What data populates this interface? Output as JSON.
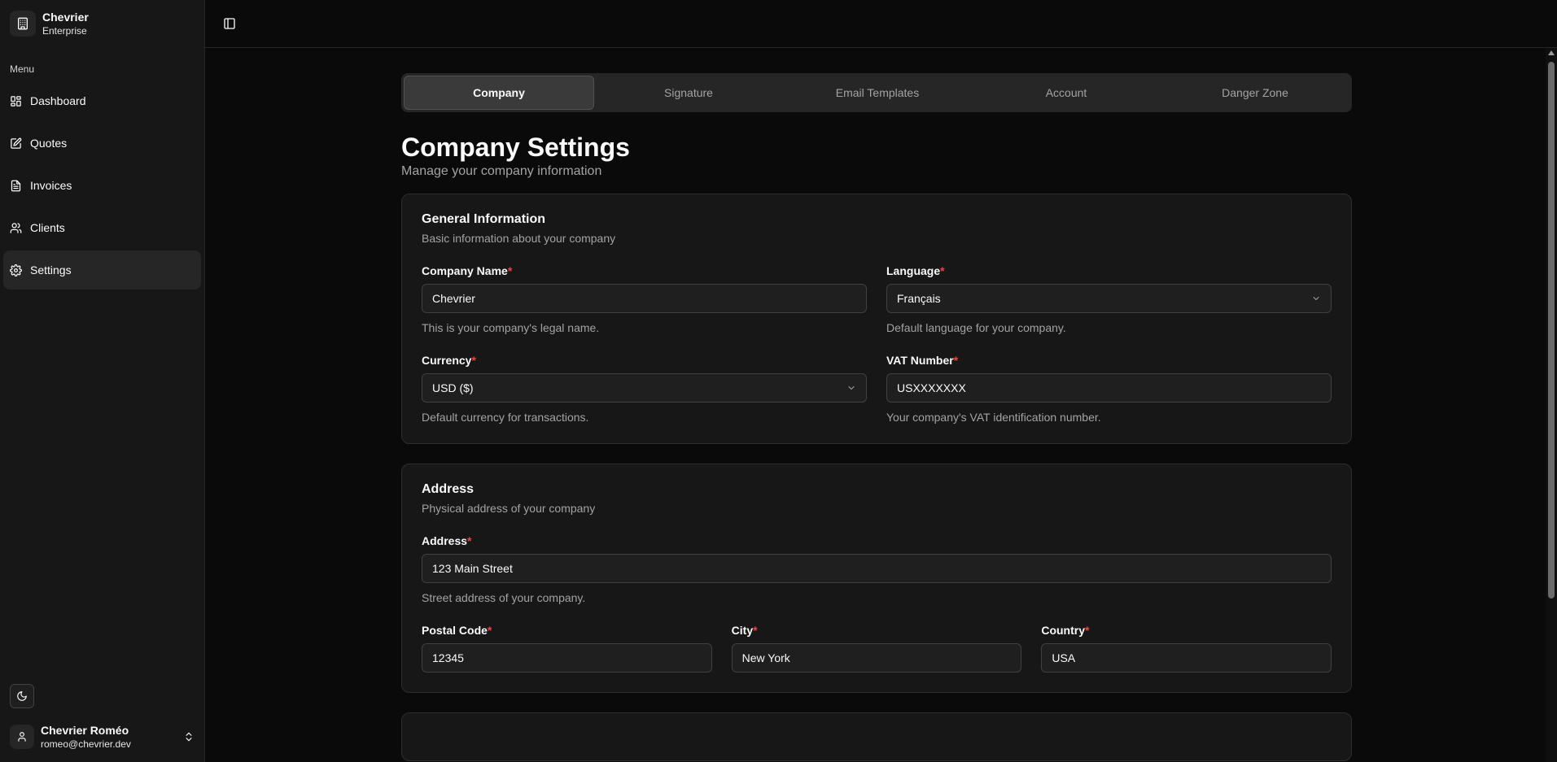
{
  "brand": {
    "name": "Chevrier",
    "plan": "Enterprise"
  },
  "sidebar": {
    "menu_label": "Menu",
    "items": [
      {
        "label": "Dashboard",
        "icon": "dashboard-icon"
      },
      {
        "label": "Quotes",
        "icon": "quote-icon"
      },
      {
        "label": "Invoices",
        "icon": "invoice-icon"
      },
      {
        "label": "Clients",
        "icon": "users-icon"
      },
      {
        "label": "Settings",
        "icon": "gear-icon",
        "active": true
      }
    ]
  },
  "user": {
    "name": "Chevrier Roméo",
    "email": "romeo@chevrier.dev"
  },
  "tabs": [
    {
      "label": "Company",
      "active": true
    },
    {
      "label": "Signature"
    },
    {
      "label": "Email Templates"
    },
    {
      "label": "Account"
    },
    {
      "label": "Danger Zone"
    }
  ],
  "page": {
    "title": "Company Settings",
    "subtitle": "Manage your company information"
  },
  "general": {
    "title": "General Information",
    "subtitle": "Basic information about your company",
    "company_name": {
      "label": "Company Name",
      "value": "Chevrier",
      "hint": "This is your company's legal name."
    },
    "language": {
      "label": "Language",
      "value": "Français",
      "hint": "Default language for your company."
    },
    "currency": {
      "label": "Currency",
      "value": "USD ($)",
      "hint": "Default currency for transactions."
    },
    "vat": {
      "label": "VAT Number",
      "value": "USXXXXXXX",
      "hint": "Your company's VAT identification number."
    }
  },
  "address": {
    "title": "Address",
    "subtitle": "Physical address of your company",
    "street": {
      "label": "Address",
      "value": "123 Main Street",
      "hint": "Street address of your company."
    },
    "postal": {
      "label": "Postal Code",
      "value": "12345"
    },
    "city": {
      "label": "City",
      "value": "New York"
    },
    "country": {
      "label": "Country",
      "value": "USA"
    }
  },
  "required_mark": "*",
  "colors": {
    "accent_required": "#ef4444",
    "background": "#0a0a0a",
    "card": "#171717"
  }
}
